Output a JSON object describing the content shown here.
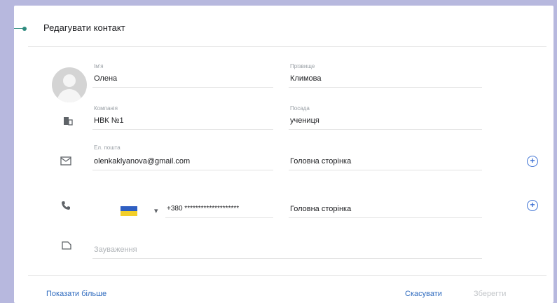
{
  "dialog": {
    "title": "Редагувати контакт"
  },
  "fields": {
    "first_name": {
      "label": "Ім'я",
      "value": "Олена"
    },
    "last_name": {
      "label": "Прізвище",
      "value": "Климова"
    },
    "company": {
      "label": "Компанія",
      "value": "НВК №1"
    },
    "position": {
      "label": "Посада",
      "value": "учениця"
    },
    "email": {
      "label": "Ел. пошта",
      "value": "olenkaklyanova@gmail.com",
      "type": "Головна сторінка"
    },
    "phone": {
      "code": "+380 ********************",
      "type": "Головна сторінка"
    },
    "notes": {
      "placeholder": "Зауваження"
    }
  },
  "actions": {
    "show_more": "Показати більше",
    "cancel": "Скасувати",
    "save": "Зберегти"
  },
  "icons": [
    "avatar-icon",
    "building-icon",
    "email-icon",
    "phone-icon",
    "note-icon",
    "plus-icon",
    "ua-flag-icon",
    "dropdown-icon"
  ],
  "colors": {
    "accent": "#2e8b7e",
    "link": "#2f6bbf",
    "background": "#b7b8de"
  }
}
